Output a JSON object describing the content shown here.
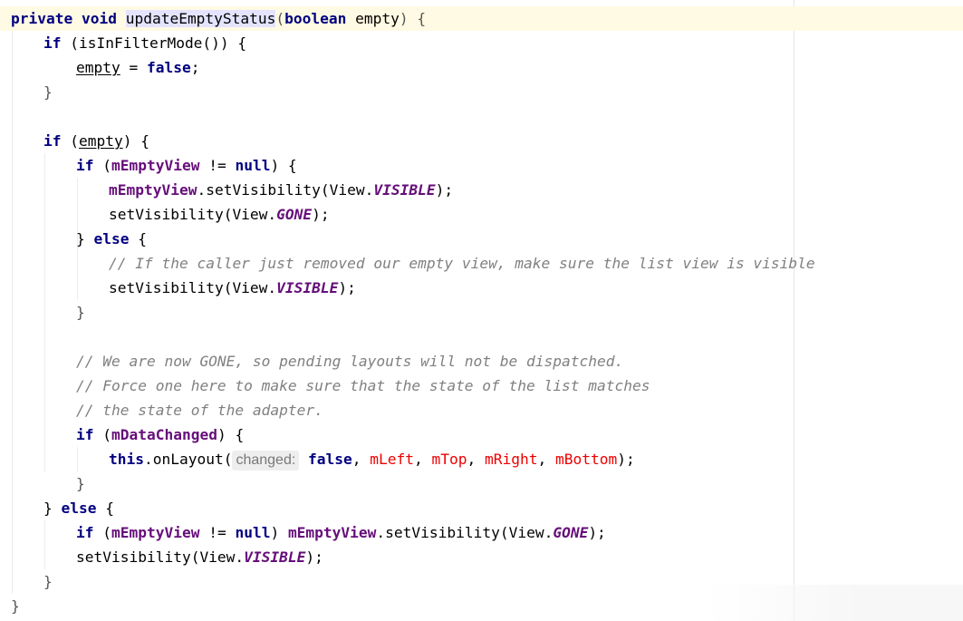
{
  "editor": {
    "language": "Java",
    "lines": [
      {
        "indent": 0,
        "caret_line": true,
        "tokens": [
          {
            "t": "private",
            "c": "kw"
          },
          {
            "t": " ",
            "c": ""
          },
          {
            "t": "void",
            "c": "kw"
          },
          {
            "t": " ",
            "c": ""
          },
          {
            "t": "updateEmptyStatus",
            "c": "hl-method"
          },
          {
            "t": "(",
            "c": "punct"
          },
          {
            "t": "boolean",
            "c": "kw"
          },
          {
            "t": " empty",
            "c": ""
          },
          {
            "t": ") {",
            "c": "punct"
          }
        ]
      },
      {
        "indent": 1,
        "tokens": [
          {
            "t": "if",
            "c": "kw"
          },
          {
            "t": " (isInFilterMode()) {",
            "c": ""
          }
        ]
      },
      {
        "indent": 2,
        "tokens": [
          {
            "t": "empty",
            "c": "under"
          },
          {
            "t": " = ",
            "c": ""
          },
          {
            "t": "false",
            "c": "kw"
          },
          {
            "t": ";",
            "c": ""
          }
        ]
      },
      {
        "indent": 1,
        "tokens": [
          {
            "t": "}",
            "c": "punct"
          }
        ]
      },
      {
        "indent": 0,
        "tokens": []
      },
      {
        "indent": 1,
        "tokens": [
          {
            "t": "if",
            "c": "kw"
          },
          {
            "t": " (",
            "c": ""
          },
          {
            "t": "empty",
            "c": "under"
          },
          {
            "t": ") {",
            "c": ""
          }
        ]
      },
      {
        "indent": 2,
        "tokens": [
          {
            "t": "if",
            "c": "kw"
          },
          {
            "t": " (",
            "c": ""
          },
          {
            "t": "mEmptyView",
            "c": "fld"
          },
          {
            "t": " != ",
            "c": ""
          },
          {
            "t": "null",
            "c": "kw"
          },
          {
            "t": ") {",
            "c": ""
          }
        ]
      },
      {
        "indent": 3,
        "tokens": [
          {
            "t": "mEmptyView",
            "c": "fld"
          },
          {
            "t": ".setVisibility(View.",
            "c": ""
          },
          {
            "t": "VISIBLE",
            "c": "const"
          },
          {
            "t": ");",
            "c": ""
          }
        ]
      },
      {
        "indent": 3,
        "tokens": [
          {
            "t": "setVisibility(View.",
            "c": ""
          },
          {
            "t": "GONE",
            "c": "const"
          },
          {
            "t": ");",
            "c": ""
          }
        ]
      },
      {
        "indent": 2,
        "tokens": [
          {
            "t": "} ",
            "c": ""
          },
          {
            "t": "else",
            "c": "kw"
          },
          {
            "t": " {",
            "c": ""
          }
        ]
      },
      {
        "indent": 3,
        "tokens": [
          {
            "t": "// If the caller just removed our empty view, make sure the list view is visible",
            "c": "cmt"
          }
        ]
      },
      {
        "indent": 3,
        "tokens": [
          {
            "t": "setVisibility(View.",
            "c": ""
          },
          {
            "t": "VISIBLE",
            "c": "const"
          },
          {
            "t": ");",
            "c": ""
          }
        ]
      },
      {
        "indent": 2,
        "tokens": [
          {
            "t": "}",
            "c": "punct"
          }
        ]
      },
      {
        "indent": 0,
        "tokens": []
      },
      {
        "indent": 2,
        "tokens": [
          {
            "t": "// We are now GONE, so pending layouts will not be dispatched.",
            "c": "cmt"
          }
        ]
      },
      {
        "indent": 2,
        "tokens": [
          {
            "t": "// Force one here to make sure that the state of the list matches",
            "c": "cmt"
          }
        ]
      },
      {
        "indent": 2,
        "tokens": [
          {
            "t": "// the state of the adapter.",
            "c": "cmt"
          }
        ]
      },
      {
        "indent": 2,
        "tokens": [
          {
            "t": "if",
            "c": "kw"
          },
          {
            "t": " (",
            "c": ""
          },
          {
            "t": "mDataChanged",
            "c": "fld"
          },
          {
            "t": ") {",
            "c": ""
          }
        ]
      },
      {
        "indent": 3,
        "tokens": [
          {
            "t": "this",
            "c": "kw"
          },
          {
            "t": ".onLayout(",
            "c": ""
          },
          {
            "t": "changed:",
            "c": "hint"
          },
          {
            "t": " ",
            "c": ""
          },
          {
            "t": "false",
            "c": "kw"
          },
          {
            "t": ", ",
            "c": ""
          },
          {
            "t": "mLeft",
            "c": "red"
          },
          {
            "t": ", ",
            "c": ""
          },
          {
            "t": "mTop",
            "c": "red"
          },
          {
            "t": ", ",
            "c": ""
          },
          {
            "t": "mRight",
            "c": "red"
          },
          {
            "t": ", ",
            "c": ""
          },
          {
            "t": "mBottom",
            "c": "red"
          },
          {
            "t": ");",
            "c": ""
          }
        ]
      },
      {
        "indent": 2,
        "tokens": [
          {
            "t": "}",
            "c": "punct"
          }
        ]
      },
      {
        "indent": 1,
        "tokens": [
          {
            "t": "} ",
            "c": ""
          },
          {
            "t": "else",
            "c": "kw"
          },
          {
            "t": " {",
            "c": ""
          }
        ]
      },
      {
        "indent": 2,
        "tokens": [
          {
            "t": "if",
            "c": "kw"
          },
          {
            "t": " (",
            "c": ""
          },
          {
            "t": "mEmptyView",
            "c": "fld"
          },
          {
            "t": " != ",
            "c": ""
          },
          {
            "t": "null",
            "c": "kw"
          },
          {
            "t": ") ",
            "c": ""
          },
          {
            "t": "mEmptyView",
            "c": "fld"
          },
          {
            "t": ".setVisibility(View.",
            "c": ""
          },
          {
            "t": "GONE",
            "c": "const"
          },
          {
            "t": ");",
            "c": ""
          }
        ]
      },
      {
        "indent": 2,
        "tokens": [
          {
            "t": "setVisibility(View.",
            "c": ""
          },
          {
            "t": "VISIBLE",
            "c": "const"
          },
          {
            "t": ");",
            "c": ""
          }
        ]
      },
      {
        "indent": 1,
        "tokens": [
          {
            "t": "}",
            "c": "punct"
          }
        ]
      },
      {
        "indent": 0,
        "tokens": [
          {
            "t": "}",
            "c": "punct"
          }
        ]
      }
    ]
  }
}
